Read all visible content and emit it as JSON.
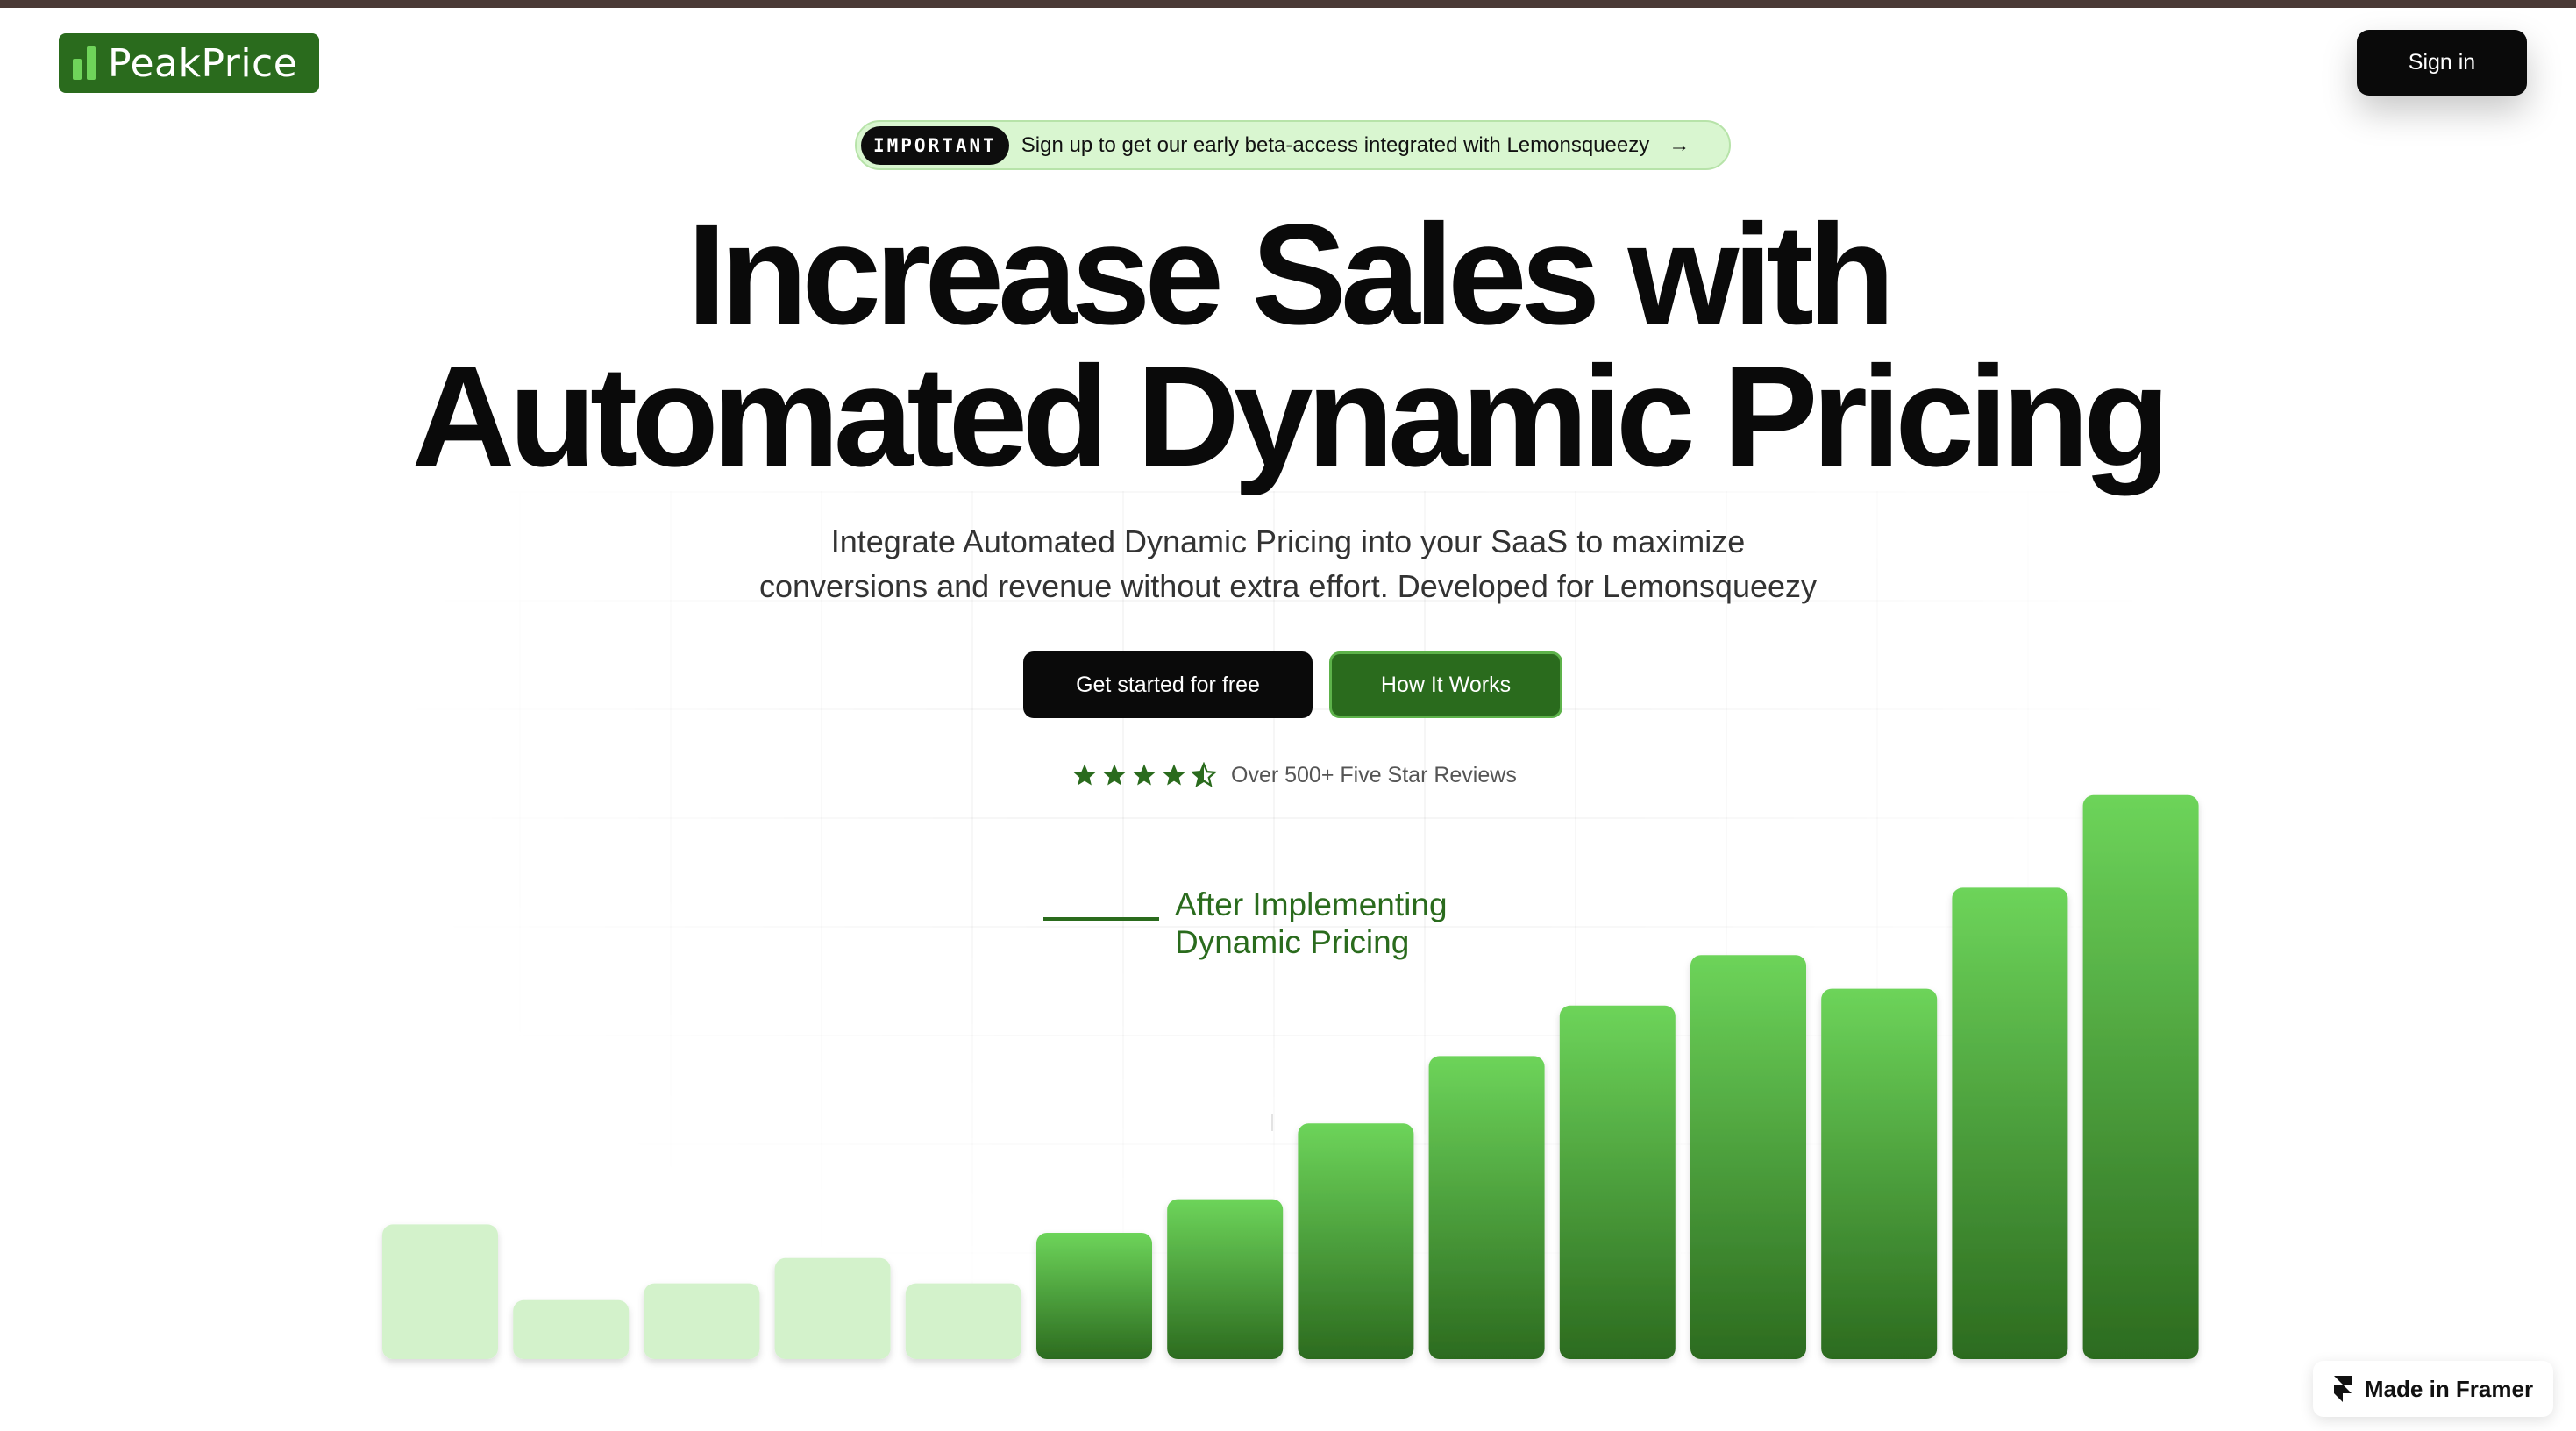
{
  "brand": {
    "name": "PeakPrice",
    "logo_icon": "bar-chart-logo-icon"
  },
  "header": {
    "signin_label": "Sign in"
  },
  "announcement": {
    "tag": "IMPORTANT",
    "text": "Sign up to get our early beta-access integrated with Lemonsqueezy",
    "arrow": "→"
  },
  "hero": {
    "headline_line1": "Increase Sales with",
    "headline_line2": "Automated Dynamic Pricing",
    "subhead_line1": "Integrate Automated Dynamic Pricing into your SaaS to maximize",
    "subhead_line2": "conversions and revenue without extra effort. Developed for Lemonsqueezy",
    "cta_primary": "Get started for free",
    "cta_secondary": "How It Works"
  },
  "rating": {
    "stars": 4.5,
    "text": "Over 500+ Five Star Reviews"
  },
  "chart_data": {
    "type": "bar",
    "annotation_line1": "After Implementing",
    "annotation_line2": "Dynamic Pricing",
    "values": [
      16,
      7,
      9,
      12,
      9,
      15,
      19,
      28,
      36,
      42,
      48,
      44,
      56,
      67
    ],
    "after_start_index": 5,
    "ylim": [
      0,
      70
    ],
    "colors": {
      "before": "#d3f2cb",
      "after_top": "#6dd45a",
      "after_bottom": "#2c6b1f"
    }
  },
  "colors": {
    "brand": "#2a6b1d",
    "accent": "#6fd45a",
    "dark": "#0a0a0a"
  },
  "framer_badge": {
    "label": "Made in Framer",
    "icon": "framer-icon"
  }
}
